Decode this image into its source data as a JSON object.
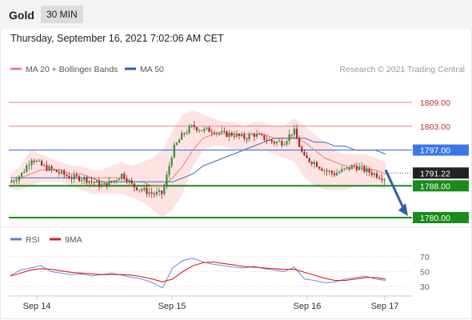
{
  "header": {
    "symbol": "Gold",
    "interval": "30 MIN",
    "timestamp": "Thursday, September 16, 2021 7:02:06 AM CET"
  },
  "legend": {
    "items": [
      {
        "label": "MA 20 + Bollinger Bands",
        "color": "#f08080"
      },
      {
        "label": "MA 50",
        "color": "#2d5fa8"
      }
    ],
    "copyright": "Research © 2021 Trading Central"
  },
  "colors": {
    "resistance": "#f08080",
    "blue_level": "#3b78e7",
    "support": "#1a8a1a",
    "bull_candle": "#3a8a3a",
    "bear_candle": "#b22222",
    "band_fill": "#fde0e0",
    "ma50": "#3d6db5",
    "ma20": "#e88080",
    "forecast_arrow": "#2d5fa8",
    "rsi": "#5b7fd6",
    "rsi_ma": "#d42020"
  },
  "chart_data": [
    {
      "type": "candlestick",
      "title": "Gold 30 MIN",
      "x": [
        "Sep 14",
        "Sep 15",
        "Sep 16",
        "Sep 17"
      ],
      "ylim": [
        1778.6,
        1813.4
      ],
      "levels": [
        {
          "value": 1809.0,
          "label": "1809.00",
          "kind": "resistance"
        },
        {
          "value": 1803.0,
          "label": "1803.00",
          "kind": "resistance"
        },
        {
          "value": 1797.0,
          "label": "1797.00",
          "kind": "pivot"
        },
        {
          "value": 1788.0,
          "label": "1788.00",
          "kind": "support"
        },
        {
          "value": 1780.0,
          "label": "1780.00",
          "kind": "support"
        }
      ],
      "last_price": {
        "value": 1791.22,
        "label": "1791.22"
      },
      "forecast_target": 1780.0,
      "series": [
        {
          "name": "MA 20 + Bollinger Bands",
          "kind": "bands",
          "approx_close_path": [
            1789,
            1791,
            1795,
            1793,
            1792,
            1791,
            1790,
            1790,
            1789,
            1788,
            1789,
            1791,
            1788,
            1787,
            1786,
            1786,
            1797,
            1801,
            1803,
            1802,
            1802,
            1801,
            1801,
            1800,
            1801,
            1800,
            1799,
            1799,
            1802,
            1795,
            1794,
            1792,
            1791,
            1792,
            1793,
            1792,
            1791,
            1790
          ]
        },
        {
          "name": "MA 50",
          "kind": "line"
        }
      ]
    },
    {
      "type": "line",
      "title": "RSI",
      "x": [
        "Sep 14",
        "Sep 15",
        "Sep 16",
        "Sep 17"
      ],
      "yticks": [
        70,
        50,
        30
      ],
      "ylim": [
        25,
        75
      ],
      "series": [
        {
          "name": "RSI",
          "values": [
            45,
            52,
            55,
            58,
            50,
            48,
            46,
            47,
            44,
            46,
            48,
            45,
            42,
            40,
            35,
            28,
            55,
            65,
            68,
            63,
            60,
            58,
            56,
            55,
            57,
            54,
            52,
            50,
            56,
            40,
            38,
            35,
            36,
            40,
            42,
            44,
            40,
            38
          ]
        },
        {
          "name": "9MA",
          "values": [
            44,
            48,
            52,
            54,
            53,
            51,
            49,
            48,
            47,
            46,
            46,
            46,
            45,
            43,
            40,
            36,
            40,
            50,
            58,
            62,
            63,
            61,
            59,
            57,
            56,
            55,
            54,
            53,
            53,
            49,
            45,
            41,
            38,
            38,
            40,
            42,
            42,
            40
          ]
        }
      ]
    }
  ]
}
